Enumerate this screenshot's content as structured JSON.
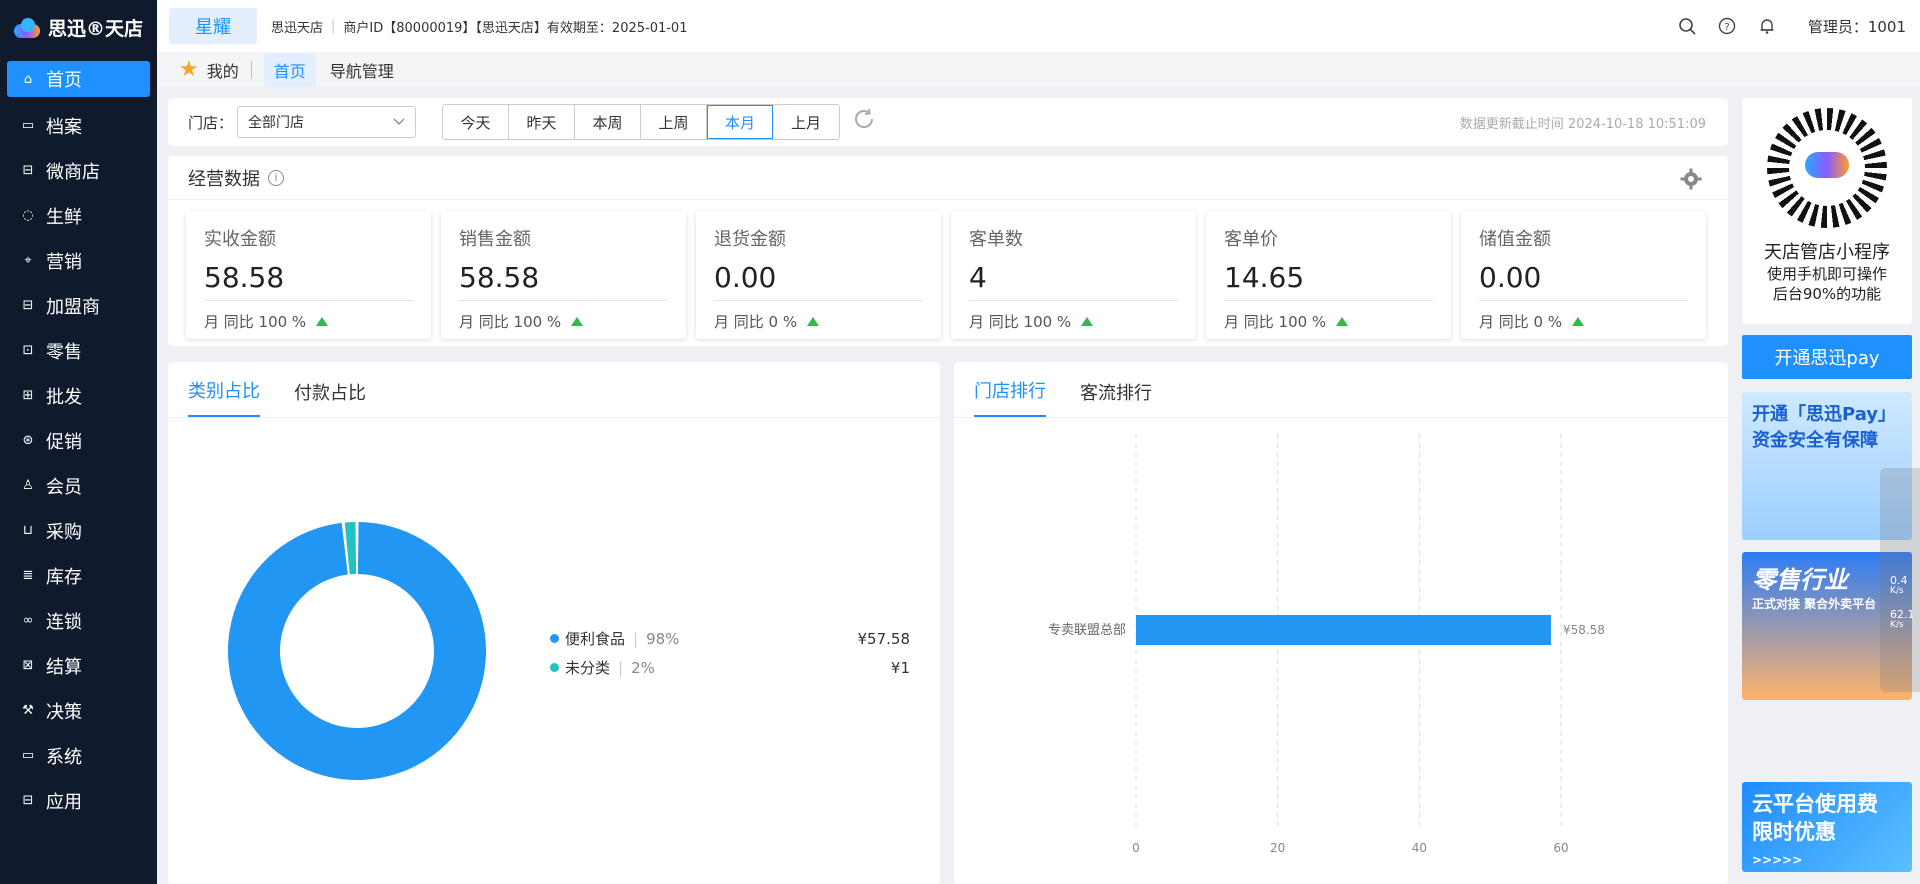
{
  "app": {
    "logo_text": "思迅®天店"
  },
  "sidebar": {
    "items": [
      {
        "label": "首页",
        "icon": "home-icon"
      },
      {
        "label": "档案",
        "icon": "folder-icon"
      },
      {
        "label": "微商店",
        "icon": "store-icon"
      },
      {
        "label": "生鲜",
        "icon": "apple-icon"
      },
      {
        "label": "营销",
        "icon": "marketing-icon"
      },
      {
        "label": "加盟商",
        "icon": "franchise-icon"
      },
      {
        "label": "零售",
        "icon": "bag-icon"
      },
      {
        "label": "批发",
        "icon": "wholesale-icon"
      },
      {
        "label": "促销",
        "icon": "promo-icon"
      },
      {
        "label": "会员",
        "icon": "user-icon"
      },
      {
        "label": "采购",
        "icon": "cart-icon"
      },
      {
        "label": "库存",
        "icon": "inventory-icon"
      },
      {
        "label": "连锁",
        "icon": "link-icon"
      },
      {
        "label": "结算",
        "icon": "settlement-icon"
      },
      {
        "label": "决策",
        "icon": "gavel-icon"
      },
      {
        "label": "系统",
        "icon": "monitor-icon"
      },
      {
        "label": "应用",
        "icon": "app-icon"
      }
    ]
  },
  "topbar": {
    "brand_tab": "星耀",
    "store_name": "思迅天店",
    "merchant_info": "商户ID【80000019】【思迅天店】有效期至：2025-01-01",
    "admin": "管理员：1001"
  },
  "subnav": {
    "mine": "我的",
    "home": "首页",
    "nav_manage": "导航管理"
  },
  "filter": {
    "store_label": "门店：",
    "store_value": "全部门店",
    "periods": [
      "今天",
      "昨天",
      "本周",
      "上周",
      "本月",
      "上月"
    ],
    "active_period": "本月",
    "updated": "数据更新截止时间 2024-10-18 10:51:09"
  },
  "business": {
    "title": "经营数据",
    "cards": [
      {
        "label": "实收金额",
        "value": "58.58",
        "cmp": "月 同比 100 %"
      },
      {
        "label": "销售金额",
        "value": "58.58",
        "cmp": "月 同比 100 %"
      },
      {
        "label": "退货金额",
        "value": "0.00",
        "cmp": "月 同比 0 %"
      },
      {
        "label": "客单数",
        "value": "4",
        "cmp": "月 同比 100 %"
      },
      {
        "label": "客单价",
        "value": "14.65",
        "cmp": "月 同比 100 %"
      },
      {
        "label": "储值金额",
        "value": "0.00",
        "cmp": "月 同比 0 %"
      }
    ]
  },
  "category": {
    "tabs": [
      "类别占比",
      "付款占比"
    ],
    "legend": [
      {
        "name": "便利食品",
        "pct": "98%",
        "value": "¥57.58",
        "color": "#2196f3"
      },
      {
        "name": "未分类",
        "pct": "2%",
        "value": "¥1",
        "color": "#22c1c3"
      }
    ]
  },
  "ranking": {
    "tabs": [
      "门店排行",
      "客流排行"
    ]
  },
  "chart_data": [
    {
      "type": "pie",
      "categories": [
        "便利食品",
        "未分类"
      ],
      "values": [
        57.58,
        1
      ],
      "colors": [
        "#2196f3",
        "#22c1c3"
      ]
    },
    {
      "type": "bar",
      "orientation": "horizontal",
      "categories": [
        "专卖联盟总部"
      ],
      "values": [
        58.58
      ],
      "value_labels": [
        "¥58.58"
      ],
      "xlim": [
        0,
        60
      ],
      "xticks": [
        "0",
        "20",
        "40",
        "60"
      ],
      "color": "#2196f3"
    }
  ],
  "promo": {
    "title": "天店管店小程序",
    "desc1": "使用手机即可操作",
    "desc2": "后台90%的功能",
    "pay_button": "开通思迅pay",
    "ad1_line1": "开通「思迅Pay」",
    "ad1_line2": "资金安全有保障",
    "ad2_line1": "零售行业",
    "ad2_line2": "正式对接 聚合外卖平台",
    "ad3_line1": "云平台使用费",
    "ad3_line2": "限时优惠",
    "ad3_arrows": ">>>>>"
  },
  "side_widget": {
    "up": "0.4",
    "up_unit": "K/s",
    "down": "62.1",
    "down_unit": "K/s"
  }
}
